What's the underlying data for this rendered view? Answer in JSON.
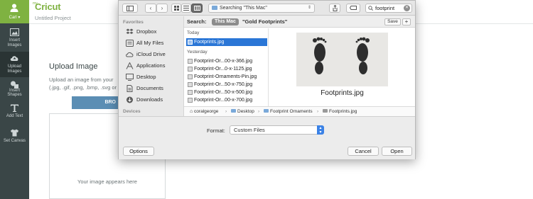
{
  "app": {
    "brand_prefix": "my",
    "brand": "Cricut",
    "project_title": "Untitled Project",
    "user_name": "Carl",
    "accent": "#7fb241",
    "rail_items": [
      {
        "label_line1": "Insert",
        "label_line2": "Images",
        "icon": "image-icon"
      },
      {
        "label_line1": "Upload",
        "label_line2": "Images",
        "icon": "cloud-upload-icon"
      },
      {
        "label_line1": "Insert",
        "label_line2": "Shapes",
        "icon": "shapes-icon"
      },
      {
        "label_line1": "Add Text",
        "label_line2": "",
        "icon": "text-icon"
      },
      {
        "label_line1": "Set Canvas",
        "label_line2": "",
        "icon": "shirt-icon"
      }
    ],
    "upload": {
      "title": "Upload Image",
      "desc_line1": "Upload an image from your",
      "desc_line2": "(.jpg, .gif, .png, .bmp, .svg or",
      "browse_label": "BRO",
      "drop_text": "Your image appears here"
    }
  },
  "dialog": {
    "toolbar": {
      "location": "Searching \"This Mac\"",
      "search_value": "footprint"
    },
    "sidebar": {
      "favorites_heading": "Favorites",
      "devices_heading": "Devices",
      "items": [
        {
          "label": "Dropbox",
          "icon": "dropbox-icon"
        },
        {
          "label": "All My Files",
          "icon": "all-files-icon"
        },
        {
          "label": "iCloud Drive",
          "icon": "cloud-icon"
        },
        {
          "label": "Applications",
          "icon": "applications-icon"
        },
        {
          "label": "Desktop",
          "icon": "desktop-icon"
        },
        {
          "label": "Documents",
          "icon": "documents-icon"
        },
        {
          "label": "Downloads",
          "icon": "downloads-icon"
        }
      ]
    },
    "scope": {
      "label": "Search:",
      "this_mac": "This Mac",
      "gold": "\"Gold Footprints\"",
      "save": "Save",
      "plus": "+"
    },
    "files": {
      "today": "Today",
      "yesterday": "Yesterday",
      "today_items": [
        "Footprints.jpg"
      ],
      "yesterday_items": [
        "Footprint-Or...00-x-366.jpg",
        "Footprint-Or...0-x-1125.jpg",
        "Footprint-Ornaments-Pin.jpg",
        "Footprint-Or...50-x-750.jpg",
        "Footprint-Or...50-x-500.jpg",
        "Footprint-Or...00-x-700.jpg"
      ]
    },
    "preview": {
      "file_name": "Footprints.jpg"
    },
    "pathbar": [
      "coralgeorge",
      "Desktop",
      "Footprint Ornaments",
      "Footprints.jpg"
    ],
    "format": {
      "label": "Format:",
      "value": "Custom Files"
    },
    "buttons": {
      "options": "Options",
      "cancel": "Cancel",
      "open": "Open"
    }
  }
}
